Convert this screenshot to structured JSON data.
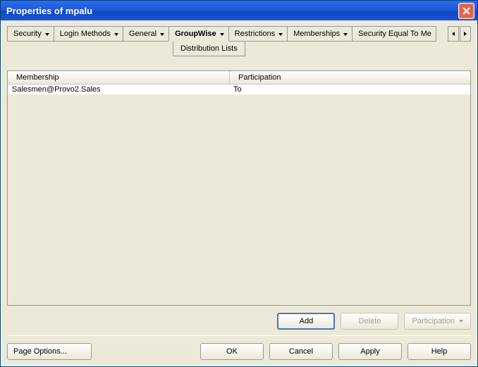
{
  "window": {
    "title": "Properties of mpalu"
  },
  "tabs": [
    {
      "label": "Security"
    },
    {
      "label": "Login Methods"
    },
    {
      "label": "General"
    },
    {
      "label": "GroupWise",
      "active": true
    },
    {
      "label": "Restrictions"
    },
    {
      "label": "Memberships"
    },
    {
      "label": "Security Equal To Me"
    }
  ],
  "subtab": {
    "label": "Distribution Lists"
  },
  "grid": {
    "columns": [
      "Membership",
      "Participation"
    ],
    "rows": [
      {
        "membership": "Salesmen@Provo2.Sales",
        "participation": "To"
      }
    ]
  },
  "actions": {
    "add": "Add",
    "delete": "Delete",
    "participation": "Participation"
  },
  "footer": {
    "page_options": "Page Options...",
    "ok": "OK",
    "cancel": "Cancel",
    "apply": "Apply",
    "help": "Help"
  }
}
